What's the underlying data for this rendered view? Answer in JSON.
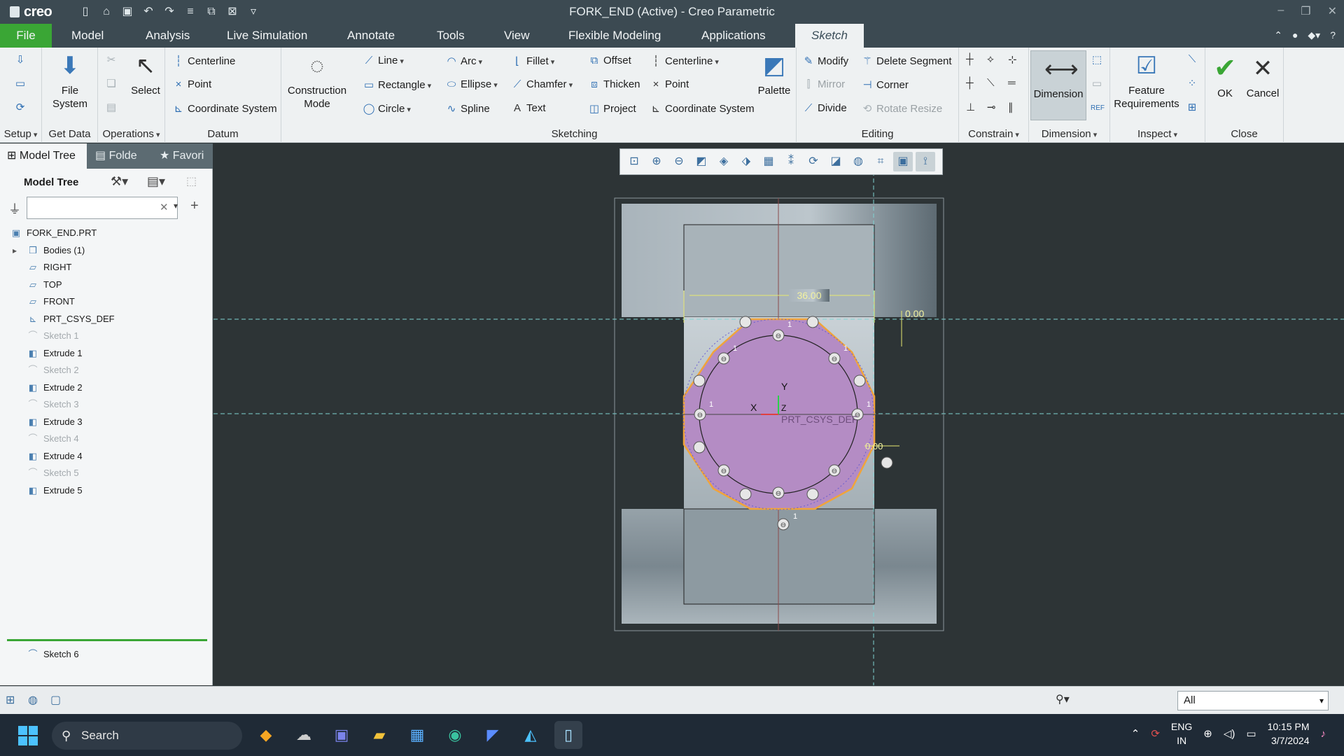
{
  "window": {
    "app_logo": "creo",
    "title": "FORK_END (Active) - Creo Parametric"
  },
  "menu": {
    "tabs": [
      "File",
      "Model",
      "Analysis",
      "Live Simulation",
      "Annotate",
      "Tools",
      "View",
      "Flexible Modeling",
      "Applications",
      "Sketch"
    ],
    "active": "Sketch"
  },
  "ribbon": {
    "groups": {
      "setup": "Setup",
      "get_data": "Get Data",
      "operations": "Operations",
      "datum": "Datum",
      "sketching": "Sketching",
      "editing": "Editing",
      "constrain": "Constrain",
      "dimension": "Dimension",
      "inspect": "Inspect",
      "close": "Close"
    },
    "get_data": {
      "file_system": "File System"
    },
    "operations": {
      "select": "Select"
    },
    "datum": {
      "centerline": "Centerline",
      "point": "Point",
      "coordinate_system": "Coordinate System"
    },
    "construction_mode": "Construction Mode",
    "sketching": {
      "line": "Line",
      "rectangle": "Rectangle",
      "circle": "Circle",
      "arc": "Arc",
      "ellipse": "Ellipse",
      "spline": "Spline",
      "fillet": "Fillet",
      "chamfer": "Chamfer",
      "text": "Text",
      "offset": "Offset",
      "thicken": "Thicken",
      "project": "Project",
      "centerline": "Centerline",
      "point": "Point",
      "coordinate_system": "Coordinate System",
      "palette": "Palette"
    },
    "editing": {
      "modify": "Modify",
      "delete_segment": "Delete Segment",
      "mirror": "Mirror",
      "corner": "Corner",
      "divide": "Divide",
      "rotate_resize": "Rotate Resize"
    },
    "dimension": {
      "dimension": "Dimension"
    },
    "inspect": {
      "feature_requirements": "Feature Requirements"
    },
    "close": {
      "ok": "OK",
      "cancel": "Cancel"
    }
  },
  "left_panel": {
    "tabs": [
      "Model Tree",
      "Folde",
      "Favori"
    ],
    "header": "Model Tree",
    "filter_placeholder": "",
    "tree": [
      {
        "label": "FORK_END.PRT",
        "icon": "part-icon",
        "dim": false
      },
      {
        "label": "Bodies (1)",
        "icon": "bodies-icon",
        "dim": false
      },
      {
        "label": "RIGHT",
        "icon": "datum-plane-icon",
        "dim": false
      },
      {
        "label": "TOP",
        "icon": "datum-plane-icon",
        "dim": false
      },
      {
        "label": "FRONT",
        "icon": "datum-plane-icon",
        "dim": false
      },
      {
        "label": "PRT_CSYS_DEF",
        "icon": "csys-icon",
        "dim": false
      },
      {
        "label": "Sketch 1",
        "icon": "sketch-icon",
        "dim": true
      },
      {
        "label": "Extrude 1",
        "icon": "extrude-icon",
        "dim": false
      },
      {
        "label": "Sketch 2",
        "icon": "sketch-icon",
        "dim": true
      },
      {
        "label": "Extrude 2",
        "icon": "extrude-icon",
        "dim": false
      },
      {
        "label": "Sketch 3",
        "icon": "sketch-icon",
        "dim": true
      },
      {
        "label": "Extrude 3",
        "icon": "extrude-icon",
        "dim": false
      },
      {
        "label": "Sketch 4",
        "icon": "sketch-icon",
        "dim": true
      },
      {
        "label": "Extrude 4",
        "icon": "extrude-icon",
        "dim": false
      },
      {
        "label": "Sketch 5",
        "icon": "sketch-icon",
        "dim": true
      },
      {
        "label": "Extrude 5",
        "icon": "extrude-icon",
        "dim": false
      }
    ],
    "active_sketch": "Sketch 6"
  },
  "graphics": {
    "dim_width": "36.00",
    "dim_top": "0.00",
    "dim_side": "0.00",
    "axis_x": "X",
    "axis_y": "Y",
    "axis_z": "Z",
    "csys_label": "PRT_CSYS_DEF",
    "constraint_equal": "1"
  },
  "status": {
    "filter_value": "All"
  },
  "taskbar": {
    "search_label": "Search",
    "lang_line1": "ENG",
    "lang_line2": "IN",
    "time": "10:15 PM",
    "date": "3/7/2024"
  },
  "colors": {
    "accent_green": "#3aa635",
    "titlebar": "#3c4a52",
    "sketch_fill": "#b48cc4",
    "sketch_outline": "#f0a43a"
  }
}
